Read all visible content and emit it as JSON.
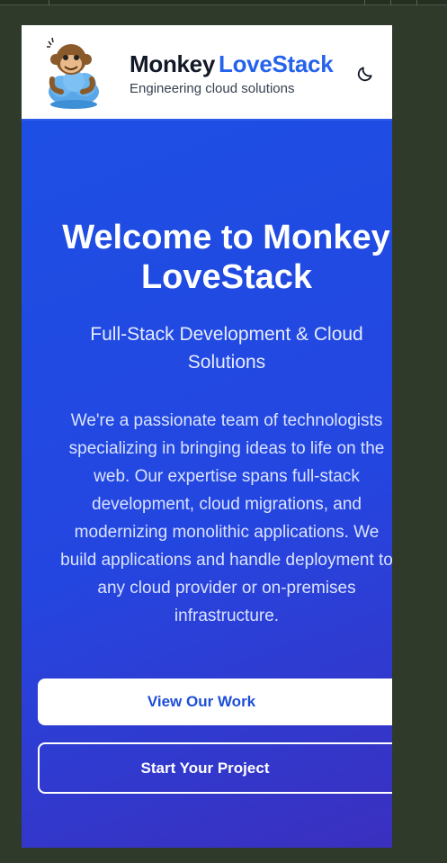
{
  "header": {
    "brand_part1": "Monkey",
    "brand_part2": "LoveStack",
    "tagline": "Engineering cloud solutions",
    "logo_icon": "monkey-cloud-logo",
    "theme_toggle_icon": "moon-icon"
  },
  "hero": {
    "title_line1": "Welcome to Monkey",
    "title_line2": "LoveStack",
    "subtitle": "Full-Stack Development & Cloud Solutions",
    "description_lines": [
      "We're a passionate team of technologists",
      "specializing in bringing ideas to life on the",
      "web. Our expertise spans full-stack",
      "development, cloud migrations, and",
      "modernizing monolithic applications. We",
      "build applications and handle deployment to",
      "any cloud provider or on-premises",
      "infrastructure."
    ],
    "primary_button": "View Our Work",
    "secondary_button": "Start Your Project"
  },
  "colors": {
    "brand_blue": "#2563eb",
    "hero_gradient_start": "#1d4fe4",
    "hero_gradient_end": "#3b2fbf",
    "outer_background": "#2f3a2b"
  }
}
